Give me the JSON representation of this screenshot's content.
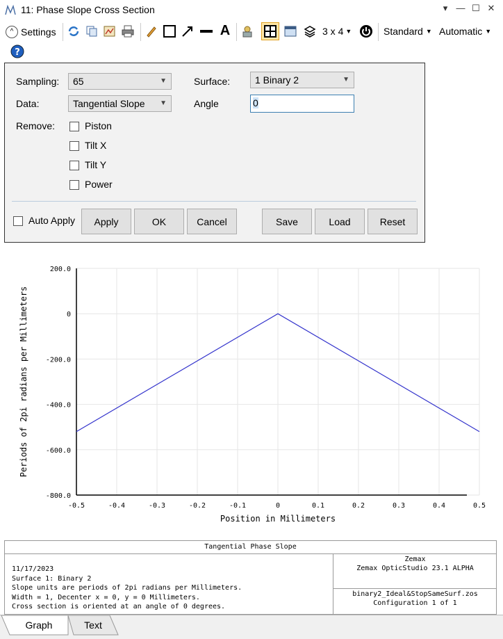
{
  "window": {
    "title": "11: Phase Slope Cross Section"
  },
  "toolbar": {
    "settings_label": "Settings",
    "layout_label": "3 x 4",
    "standard_label": "Standard",
    "automatic_label": "Automatic"
  },
  "settings": {
    "sampling_label": "Sampling:",
    "sampling_value": "65",
    "surface_label": "Surface:",
    "surface_value": "1 Binary 2",
    "data_label": "Data:",
    "data_value": "Tangential Slope",
    "angle_label": "Angle",
    "angle_value": "0",
    "remove_label": "Remove:",
    "remove_options": [
      "Piston",
      "Tilt X",
      "Tilt Y",
      "Power"
    ],
    "auto_apply_label": "Auto Apply",
    "buttons": {
      "apply": "Apply",
      "ok": "OK",
      "cancel": "Cancel",
      "save": "Save",
      "load": "Load",
      "reset": "Reset"
    }
  },
  "chart_data": {
    "type": "line",
    "title": "Tangential Phase Slope",
    "xlabel": "Position in Millimeters",
    "ylabel": "Periods of 2pi radians per Millimeters",
    "xlim": [
      -0.5,
      0.5
    ],
    "ylim": [
      -800.0,
      200.0
    ],
    "x_ticks": [
      "-0.5",
      "-0.4",
      "-0.3",
      "-0.2",
      "-0.1",
      "0",
      "0.1",
      "0.2",
      "0.3",
      "0.4",
      "0.5"
    ],
    "y_ticks": [
      "200.0",
      "0",
      "-200.0",
      "-400.0",
      "-600.0",
      "-800.0"
    ],
    "grid": true,
    "series": [
      {
        "color": "#3333cc",
        "x": [
          -0.5,
          0.0,
          0.5
        ],
        "y": [
          -520.0,
          0.0,
          -520.0
        ]
      }
    ]
  },
  "footer": {
    "title": "Tangential Phase Slope",
    "info_lines": [
      "11/17/2023",
      "Surface 1: Binary 2",
      "Slope units are periods of 2pi radians per Millimeters.",
      "Width = 1, Decenter x = 0, y = 0 Millimeters.",
      "Cross section is oriented at an angle of 0 degrees."
    ],
    "company": "Zemax",
    "product": "Zemax OpticStudio 23.1  ALPHA",
    "file": "binary2_Ideal&StopSameSurf.zos",
    "configuration": "Configuration 1 of 1"
  },
  "tabs": [
    "Graph",
    "Text"
  ]
}
